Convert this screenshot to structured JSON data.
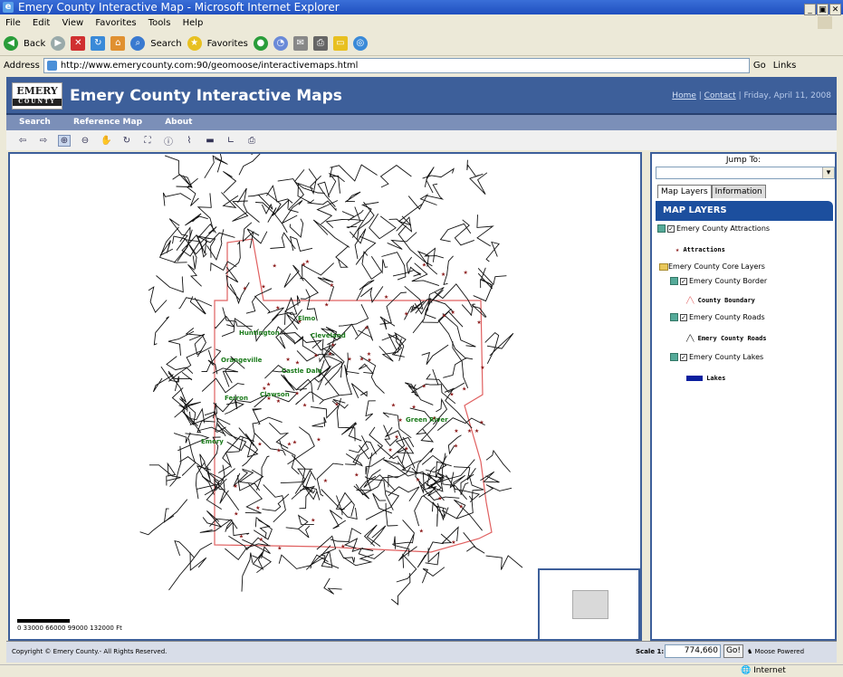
{
  "window": {
    "title": "Emery County Interactive Map - Microsoft Internet Explorer",
    "icon": "ie-icon",
    "buttons": [
      "_",
      "▣",
      "✕"
    ]
  },
  "menu": [
    "File",
    "Edit",
    "View",
    "Favorites",
    "Tools",
    "Help"
  ],
  "browser_toolbar": {
    "back": "Back",
    "search": "Search",
    "favorites": "Favorites"
  },
  "address": {
    "label": "Address",
    "url": "http://www.emerycounty.com:90/geomoose/interactivemaps.html",
    "go": "Go",
    "links": "Links"
  },
  "site": {
    "logo_main": "EMERY",
    "logo_sub": "COUNTY",
    "title": "Emery County Interactive Maps",
    "home": "Home",
    "contact": "Contact",
    "date": "Friday, April 11, 2008",
    "separator": "|"
  },
  "nav": [
    "Search",
    "Reference Map",
    "About"
  ],
  "tools": [
    "arrow-left-icon",
    "arrow-right-icon",
    "zoom-in-icon",
    "zoom-out-icon",
    "pan-icon",
    "refresh-icon",
    "zoom-extent-icon",
    "info-icon",
    "measure-icon",
    "measure-area-icon",
    "profile-icon",
    "print-icon"
  ],
  "map": {
    "towns": [
      "Elmo",
      "Huntington",
      "Cleveland",
      "Orangeville",
      "Castle Dale",
      "Ferron",
      "Clawson",
      "Green River",
      "Emery"
    ]
  },
  "scalebar": {
    "labels": "0    33000  66000  99000  132000  Ft"
  },
  "side": {
    "jump_label": "Jump To:",
    "tabs": [
      "Map Layers",
      "Information"
    ],
    "layers_header": "MAP LAYERS",
    "attractions_layer": "Emery County Attractions",
    "attractions_legend": "Attractions",
    "core_group": "Emery County Core Layers",
    "border_layer": "Emery County Border",
    "border_legend": "County Boundary",
    "roads_layer": "Emery County Roads",
    "roads_legend": "Emery County Roads",
    "lakes_layer": "Emery County Lakes",
    "lakes_legend": "Lakes"
  },
  "status": {
    "copyright": "Copyright © Emery County.- All Rights Reserved.",
    "scale_label": "Scale 1:",
    "scale_value": "774,660",
    "go": "Go!",
    "powered": "Moose Powered"
  },
  "winstatus": {
    "zone": "Internet"
  },
  "colors": {
    "header": "#3d5f9a",
    "nav": "#7b8fb8",
    "boundary": "#e06060",
    "label": "#1a7a1a",
    "lakes": "#0a1f9e"
  }
}
